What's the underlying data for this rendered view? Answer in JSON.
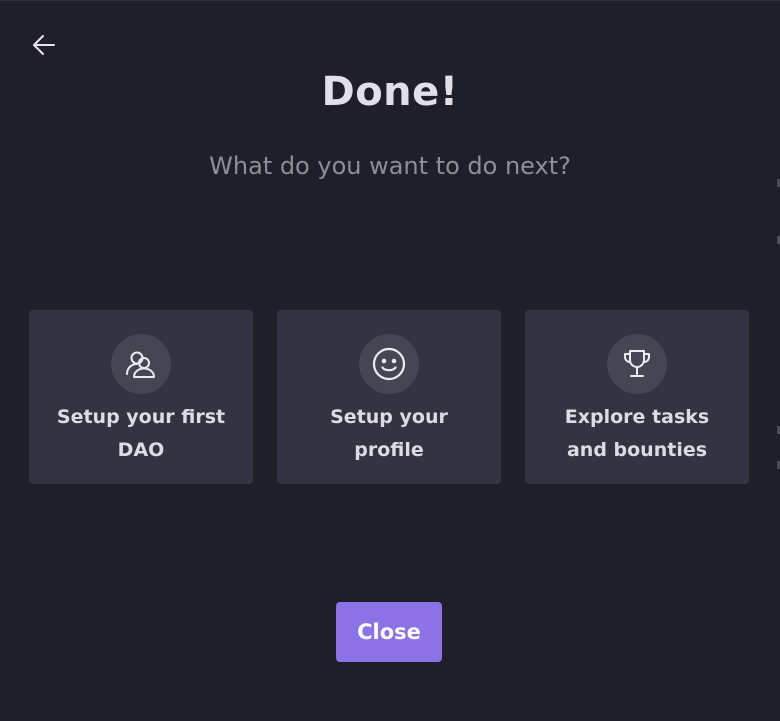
{
  "header": {
    "back_icon": "arrow-left-icon",
    "title": "Done!",
    "subtitle": "What do you want to do next?"
  },
  "cards": [
    {
      "icon": "users-icon",
      "label_line1": "Setup your first",
      "label_line2": "DAO"
    },
    {
      "icon": "smiley-icon",
      "label_line1": "Setup your",
      "label_line2": "profile"
    },
    {
      "icon": "trophy-icon",
      "label_line1": "Explore tasks",
      "label_line2": "and bounties"
    }
  ],
  "footer": {
    "close_label": "Close"
  },
  "colors": {
    "background": "#1f1f29",
    "card": "#323443",
    "icon_circle": "#454654",
    "accent": "#8b72e6",
    "title": "#e0e0e6",
    "subtitle": "#8e8e98"
  }
}
